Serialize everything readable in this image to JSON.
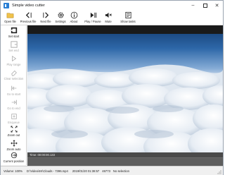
{
  "window": {
    "title": "Simple video cutter",
    "minimize_icon": "minimize-icon",
    "maximize_icon": "maximize-icon",
    "close_icon": "close-icon"
  },
  "toolbar": {
    "items": [
      {
        "label": "Open file",
        "icon": "folder-icon"
      },
      {
        "label": "Previous file",
        "icon": "previous-file-icon"
      },
      {
        "label": "Next file",
        "icon": "next-file-icon"
      },
      {
        "label": "Settings",
        "icon": "gear-icon"
      },
      {
        "label": "About",
        "icon": "info-icon"
      },
      {
        "label": "Play / Pause",
        "icon": "play-pause-icon"
      },
      {
        "label": "Mute",
        "icon": "speaker-mute-icon"
      },
      {
        "label": "Show tasks",
        "icon": "tasks-icon"
      }
    ]
  },
  "sidebar": {
    "items": [
      {
        "label": "Set start",
        "icon": "set-start-icon",
        "enabled": true
      },
      {
        "label": "Set end",
        "icon": "set-end-icon",
        "enabled": false
      },
      {
        "label": "Play range",
        "icon": "play-range-icon",
        "enabled": false
      },
      {
        "label": "Clear selection",
        "icon": "eraser-icon",
        "enabled": false
      },
      {
        "label": "Go to start",
        "icon": "go-to-start-icon",
        "enabled": false
      },
      {
        "label": "Go to end",
        "icon": "go-to-end-icon",
        "enabled": false
      },
      {
        "label": "Enqueue",
        "icon": "enqueue-icon",
        "enabled": false
      },
      {
        "label": "Zoom out",
        "icon": "zoom-out-icon",
        "enabled": true
      },
      {
        "label": "Zoom auto",
        "icon": "zoom-auto-icon",
        "enabled": true
      },
      {
        "label": "Current position",
        "icon": "current-position-icon",
        "enabled": true
      }
    ]
  },
  "timeline": {
    "time_label": "Time: 00:00:00.133"
  },
  "status": {
    "volume": "Volume: 100%",
    "file_path": "D:\\Video\\4K\\Clouds - 7396.mp4",
    "date": "2019/01/20 01:38:57",
    "size": "46773",
    "selection": "No selection"
  },
  "colors": {
    "accent": "#2a7fd4",
    "sky_top": "#1d4f8c",
    "sky_mid": "#6f9fd0",
    "cloud": "#f2f5f8",
    "timeline_bg": "#4a4a4a"
  }
}
